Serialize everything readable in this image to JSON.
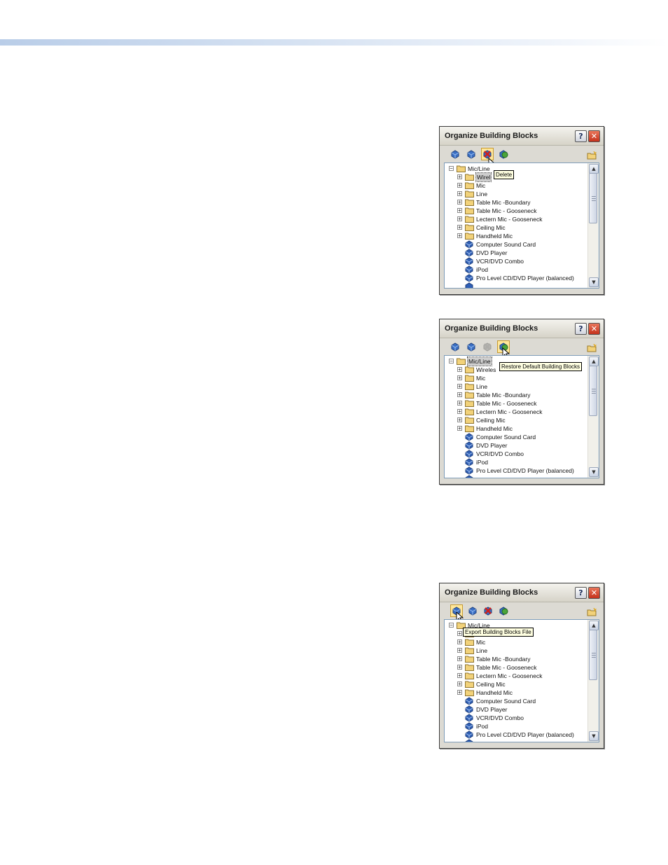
{
  "dialogs": [
    {
      "title": "Organize Building Blocks",
      "help_glyph": "?",
      "close_glyph": "✕",
      "tooltip": "Delete",
      "items": [
        {
          "label": "Mic/Line",
          "type": "folder",
          "level": 0,
          "expander": "−"
        },
        {
          "label": "Wirel",
          "type": "folder",
          "level": 1,
          "expander": "+"
        },
        {
          "label": "Mic",
          "type": "folder",
          "level": 1,
          "expander": "+"
        },
        {
          "label": "Line",
          "type": "folder",
          "level": 1,
          "expander": "+"
        },
        {
          "label": "Table Mic -Boundary",
          "type": "folder",
          "level": 1,
          "expander": "+"
        },
        {
          "label": "Table Mic - Gooseneck",
          "type": "folder",
          "level": 1,
          "expander": "+"
        },
        {
          "label": "Lectern Mic - Gooseneck",
          "type": "folder",
          "level": 1,
          "expander": "+"
        },
        {
          "label": "Ceiling Mic",
          "type": "folder",
          "level": 1,
          "expander": "+"
        },
        {
          "label": "Handheld Mic",
          "type": "folder",
          "level": 1,
          "expander": "+"
        },
        {
          "label": "Computer Sound Card",
          "type": "block",
          "level": 1
        },
        {
          "label": "DVD Player",
          "type": "block",
          "level": 1
        },
        {
          "label": "VCR/DVD Combo",
          "type": "block",
          "level": 1
        },
        {
          "label": "iPod",
          "type": "block",
          "level": 1
        },
        {
          "label": "Pro Level CD/DVD Player (balanced)",
          "type": "block",
          "level": 1
        }
      ]
    },
    {
      "title": "Organize Building Blocks",
      "help_glyph": "?",
      "close_glyph": "✕",
      "tooltip": "Restore Default Building Blocks",
      "items": [
        {
          "label": "Mic/Line",
          "type": "folder",
          "level": 0,
          "expander": "−"
        },
        {
          "label": "Wireles",
          "type": "folder",
          "level": 1,
          "expander": "+"
        },
        {
          "label": "Mic",
          "type": "folder",
          "level": 1,
          "expander": "+"
        },
        {
          "label": "Line",
          "type": "folder",
          "level": 1,
          "expander": "+"
        },
        {
          "label": "Table Mic -Boundary",
          "type": "folder",
          "level": 1,
          "expander": "+"
        },
        {
          "label": "Table Mic - Gooseneck",
          "type": "folder",
          "level": 1,
          "expander": "+"
        },
        {
          "label": "Lectern Mic - Gooseneck",
          "type": "folder",
          "level": 1,
          "expander": "+"
        },
        {
          "label": "Ceiling Mic",
          "type": "folder",
          "level": 1,
          "expander": "+"
        },
        {
          "label": "Handheld Mic",
          "type": "folder",
          "level": 1,
          "expander": "+"
        },
        {
          "label": "Computer Sound Card",
          "type": "block",
          "level": 1
        },
        {
          "label": "DVD Player",
          "type": "block",
          "level": 1
        },
        {
          "label": "VCR/DVD Combo",
          "type": "block",
          "level": 1
        },
        {
          "label": "iPod",
          "type": "block",
          "level": 1
        },
        {
          "label": "Pro Level CD/DVD Player (balanced)",
          "type": "block",
          "level": 1
        }
      ]
    },
    {
      "title": "Organize Building Blocks",
      "help_glyph": "?",
      "close_glyph": "✕",
      "tooltip": "Export Building Blocks File",
      "items": [
        {
          "label": "Mic/Line",
          "type": "folder",
          "level": 0,
          "expander": "−"
        },
        {
          "label": "",
          "type": "folder",
          "level": 1,
          "expander": "+"
        },
        {
          "label": "Mic",
          "type": "folder",
          "level": 1,
          "expander": "+"
        },
        {
          "label": "Line",
          "type": "folder",
          "level": 1,
          "expander": "+"
        },
        {
          "label": "Table Mic -Boundary",
          "type": "folder",
          "level": 1,
          "expander": "+"
        },
        {
          "label": "Table Mic - Gooseneck",
          "type": "folder",
          "level": 1,
          "expander": "+"
        },
        {
          "label": "Lectern Mic - Gooseneck",
          "type": "folder",
          "level": 1,
          "expander": "+"
        },
        {
          "label": "Ceiling Mic",
          "type": "folder",
          "level": 1,
          "expander": "+"
        },
        {
          "label": "Handheld Mic",
          "type": "folder",
          "level": 1,
          "expander": "+"
        },
        {
          "label": "Computer Sound Card",
          "type": "block",
          "level": 1
        },
        {
          "label": "DVD Player",
          "type": "block",
          "level": 1
        },
        {
          "label": "VCR/DVD Combo",
          "type": "block",
          "level": 1
        },
        {
          "label": "iPod",
          "type": "block",
          "level": 1
        },
        {
          "label": "Pro Level CD/DVD Player (balanced)",
          "type": "block",
          "level": 1
        }
      ]
    }
  ],
  "toolbar_icons": [
    "import-building-blocks-icon",
    "add-building-block-icon",
    "delete-building-block-icon",
    "restore-default-building-blocks-icon",
    "new-folder-icon"
  ],
  "colors": {
    "header_gradient_start": "#b9cde8",
    "dialog_bg": "#dcdad3",
    "tooltip_bg": "#ffffe1",
    "highlight": "#ffe79a",
    "close_red": "#c4321c",
    "block_blue": "#2f5fb5",
    "folder_yellow": "#f2d27a"
  }
}
